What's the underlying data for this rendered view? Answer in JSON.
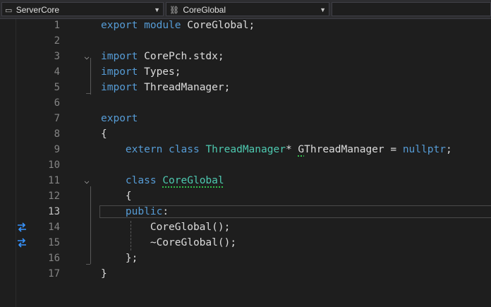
{
  "toolbar": {
    "project_dropdown": "ServerCore",
    "scope_dropdown": "CoreGlobal",
    "member_dropdown": ""
  },
  "editor": {
    "current_line": 13,
    "lines": [
      {
        "num": "1",
        "code": "export module CoreGlobal;"
      },
      {
        "num": "2",
        "code": ""
      },
      {
        "num": "3",
        "code": "import CorePch.stdx;"
      },
      {
        "num": "4",
        "code": "import Types;"
      },
      {
        "num": "5",
        "code": "import ThreadManager;"
      },
      {
        "num": "6",
        "code": ""
      },
      {
        "num": "7",
        "code": "export"
      },
      {
        "num": "8",
        "code": "{"
      },
      {
        "num": "9",
        "code": "    extern class ThreadManager* GThreadManager = nullptr;"
      },
      {
        "num": "10",
        "code": ""
      },
      {
        "num": "11",
        "code": "    class CoreGlobal"
      },
      {
        "num": "12",
        "code": "    {"
      },
      {
        "num": "13",
        "code": "    public:"
      },
      {
        "num": "14",
        "code": "        CoreGlobal();"
      },
      {
        "num": "15",
        "code": "        ~CoreGlobal();"
      },
      {
        "num": "16",
        "code": "    };"
      },
      {
        "num": "17",
        "code": "}"
      }
    ]
  },
  "colors": {
    "keyword": "#569cd6",
    "type": "#4ec9b0",
    "text": "#dcdcdc",
    "line_number": "#858585",
    "background": "#1e1e1e"
  },
  "icons": {
    "fold_glyph": "⌵",
    "margin_glyph": "swap-arrows-icon"
  }
}
